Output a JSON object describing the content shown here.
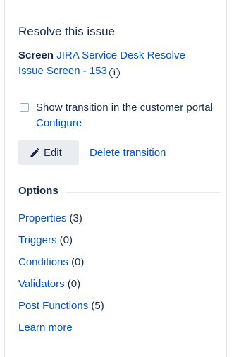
{
  "panel": {
    "title": "Resolve this issue",
    "screen_label": "Screen",
    "screen_link_line1": "JIRA Service Desk Resolve",
    "screen_link_line2": "Issue Screen - 153",
    "info_glyph": "i"
  },
  "checkbox": {
    "checked": false,
    "text": "Show transition in the customer portal",
    "configure_link": "Configure"
  },
  "actions": {
    "edit_label": "Edit",
    "delete_label": "Delete transition"
  },
  "options": {
    "heading": "Options",
    "items": [
      {
        "label": "Properties",
        "count": "(3)"
      },
      {
        "label": "Triggers",
        "count": "(0)"
      },
      {
        "label": "Conditions",
        "count": "(0)"
      },
      {
        "label": "Validators",
        "count": "(0)"
      },
      {
        "label": "Post Functions",
        "count": "(5)"
      }
    ],
    "learn_more": "Learn more"
  },
  "colors": {
    "link": "#0052cc",
    "text": "#172b4d",
    "button_bg": "#ebecf0"
  }
}
